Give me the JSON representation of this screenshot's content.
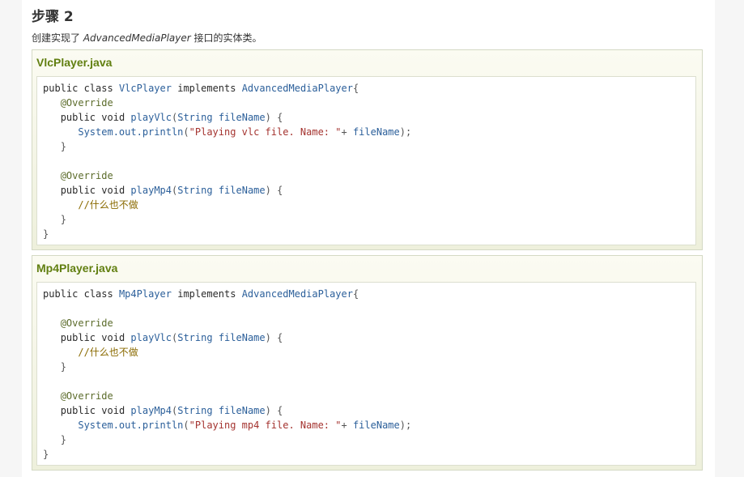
{
  "step": {
    "title": "步骤 2"
  },
  "intro": {
    "before": "创建实现了 ",
    "interface_name": "AdvancedMediaPlayer",
    "after": " 接口的实体类。"
  },
  "files": [
    {
      "name": "VlcPlayer.java",
      "lines": [
        "public class VlcPlayer implements AdvancedMediaPlayer{",
        "   @Override",
        "   public void playVlc(String fileName) {",
        "      System.out.println(\"Playing vlc file. Name: \"+ fileName);",
        "   }",
        "",
        "   @Override",
        "   public void playMp4(String fileName) {",
        "      //什么也不做",
        "   }",
        "}"
      ]
    },
    {
      "name": "Mp4Player.java",
      "lines": [
        "public class Mp4Player implements AdvancedMediaPlayer{",
        "",
        "   @Override",
        "   public void playVlc(String fileName) {",
        "      //什么也不做",
        "   }",
        "",
        "   @Override",
        "   public void playMp4(String fileName) {",
        "      System.out.println(\"Playing mp4 file. Name: \"+ fileName);",
        "   }",
        "}"
      ]
    }
  ],
  "colors": {
    "panel_title": "#617f10",
    "identifier": "#2b5f9a",
    "string": "#a4332f",
    "annotation": "#5b6b2a",
    "comment": "#8a6a00"
  }
}
